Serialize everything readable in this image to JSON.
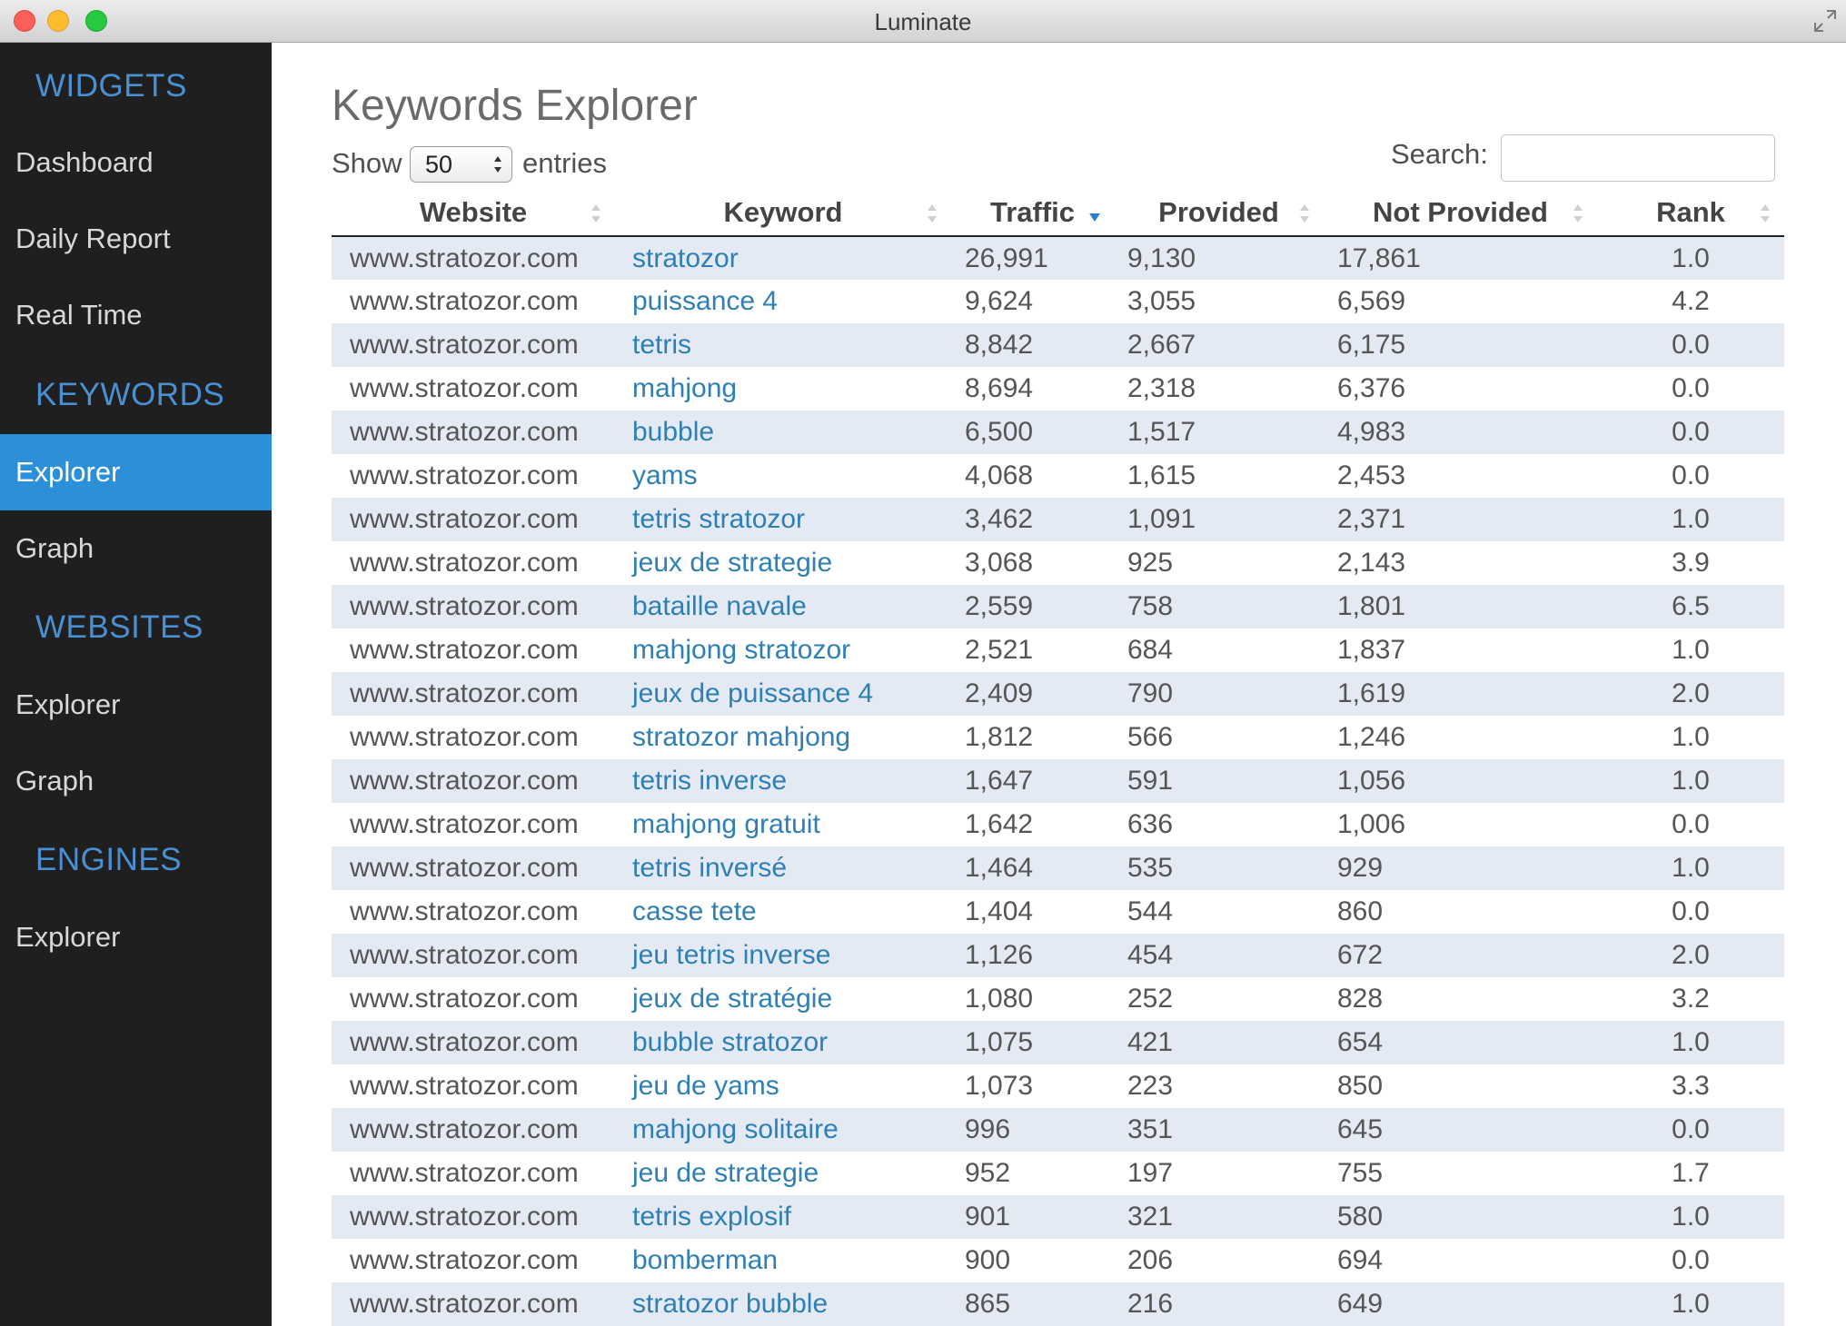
{
  "window": {
    "title": "Luminate"
  },
  "sidebar": {
    "sections": [
      {
        "heading": "WIDGETS",
        "items": [
          "Dashboard",
          "Daily Report",
          "Real Time"
        ]
      },
      {
        "heading": "KEYWORDS",
        "items": [
          "Explorer",
          "Graph"
        ]
      },
      {
        "heading": "WEBSITES",
        "items": [
          "Explorer",
          "Graph"
        ]
      },
      {
        "heading": "ENGINES",
        "items": [
          "Explorer"
        ]
      }
    ],
    "active": "KEYWORDS/Explorer"
  },
  "page": {
    "title": "Keywords Explorer",
    "show_label": "Show",
    "entries_value": "50",
    "entries_label": "entries",
    "search_label": "Search:",
    "search_value": ""
  },
  "table": {
    "columns": [
      "Website",
      "Keyword",
      "Traffic",
      "Provided",
      "Not Provided",
      "Rank"
    ],
    "sorted_column": "Traffic",
    "sort_direction": "descending",
    "rows": [
      [
        "www.stratozor.com",
        "stratozor",
        "26,991",
        "9,130",
        "17,861",
        "1.0"
      ],
      [
        "www.stratozor.com",
        "puissance 4",
        "9,624",
        "3,055",
        "6,569",
        "4.2"
      ],
      [
        "www.stratozor.com",
        "tetris",
        "8,842",
        "2,667",
        "6,175",
        "0.0"
      ],
      [
        "www.stratozor.com",
        "mahjong",
        "8,694",
        "2,318",
        "6,376",
        "0.0"
      ],
      [
        "www.stratozor.com",
        "bubble",
        "6,500",
        "1,517",
        "4,983",
        "0.0"
      ],
      [
        "www.stratozor.com",
        "yams",
        "4,068",
        "1,615",
        "2,453",
        "0.0"
      ],
      [
        "www.stratozor.com",
        "tetris stratozor",
        "3,462",
        "1,091",
        "2,371",
        "1.0"
      ],
      [
        "www.stratozor.com",
        "jeux de strategie",
        "3,068",
        "925",
        "2,143",
        "3.9"
      ],
      [
        "www.stratozor.com",
        "bataille navale",
        "2,559",
        "758",
        "1,801",
        "6.5"
      ],
      [
        "www.stratozor.com",
        "mahjong stratozor",
        "2,521",
        "684",
        "1,837",
        "1.0"
      ],
      [
        "www.stratozor.com",
        "jeux de puissance 4",
        "2,409",
        "790",
        "1,619",
        "2.0"
      ],
      [
        "www.stratozor.com",
        "stratozor mahjong",
        "1,812",
        "566",
        "1,246",
        "1.0"
      ],
      [
        "www.stratozor.com",
        "tetris inverse",
        "1,647",
        "591",
        "1,056",
        "1.0"
      ],
      [
        "www.stratozor.com",
        "mahjong gratuit",
        "1,642",
        "636",
        "1,006",
        "0.0"
      ],
      [
        "www.stratozor.com",
        "tetris inversé",
        "1,464",
        "535",
        "929",
        "1.0"
      ],
      [
        "www.stratozor.com",
        "casse tete",
        "1,404",
        "544",
        "860",
        "0.0"
      ],
      [
        "www.stratozor.com",
        "jeu tetris inverse",
        "1,126",
        "454",
        "672",
        "2.0"
      ],
      [
        "www.stratozor.com",
        "jeux de stratégie",
        "1,080",
        "252",
        "828",
        "3.2"
      ],
      [
        "www.stratozor.com",
        "bubble stratozor",
        "1,075",
        "421",
        "654",
        "1.0"
      ],
      [
        "www.stratozor.com",
        "jeu de yams",
        "1,073",
        "223",
        "850",
        "3.3"
      ],
      [
        "www.stratozor.com",
        "mahjong solitaire",
        "996",
        "351",
        "645",
        "0.0"
      ],
      [
        "www.stratozor.com",
        "jeu de strategie",
        "952",
        "197",
        "755",
        "1.7"
      ],
      [
        "www.stratozor.com",
        "tetris explosif",
        "901",
        "321",
        "580",
        "1.0"
      ],
      [
        "www.stratozor.com",
        "bomberman",
        "900",
        "206",
        "694",
        "0.0"
      ],
      [
        "www.stratozor.com",
        "stratozor bubble",
        "865",
        "216",
        "649",
        "1.0"
      ]
    ]
  },
  "colors": {
    "sidebar_bg": "#1f1f1f",
    "section_heading": "#4a8fd2",
    "active_item_bg": "#2b8fd9",
    "row_stripe": "#e4eaf4",
    "keyword_link": "#2e7fb5",
    "sort_active": "#2b7fd3"
  }
}
